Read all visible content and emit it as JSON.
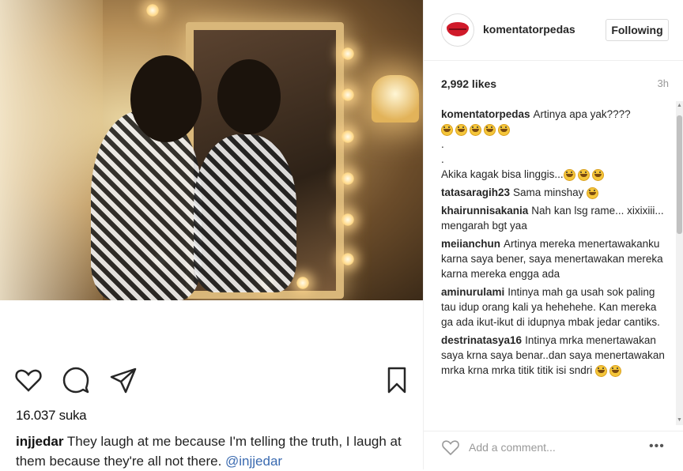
{
  "post": {
    "likes_count": "16.037 suka",
    "caption_user": "injjedar",
    "caption_text": " They laugh at me because I'm telling the truth, I laugh at them because they're all not there. ",
    "caption_mention": "@injjedar"
  },
  "header": {
    "username": "komentatorpedas",
    "follow_label": "Following"
  },
  "stats": {
    "likes": "2,992 likes",
    "time": "3h"
  },
  "comments": [
    {
      "user": "komentatorpedas",
      "text": "Artinya apa yak????"
    },
    {
      "user": "",
      "text": "."
    },
    {
      "user": "",
      "text": "."
    },
    {
      "user": "",
      "text": "Akika kagak bisa linggis..."
    },
    {
      "user": "tatasaragih23",
      "text": "Sama minshay"
    },
    {
      "user": "khairunnisakania",
      "text": "Nah kan lsg rame... xixixiii... mengarah bgt yaa"
    },
    {
      "user": "meiianchun",
      "text": "Artinya mereka menertawakanku karna saya bener, saya menertawakan mereka karna mereka engga ada"
    },
    {
      "user": "aminurulami",
      "text": "Intinya mah ga usah sok paling tau idup orang kali ya hehehehe. Kan mereka ga ada ikut-ikut di idupnya mbak jedar cantiks."
    },
    {
      "user": "destrinatasya16",
      "text": "Intinya mrka menertawakan saya krna saya benar..dan saya menertawakan mrka krna mrka titik titik isi sndri"
    }
  ],
  "add_comment": {
    "placeholder": "Add a comment..."
  },
  "colors": {
    "accent_link": "#3a6ab0",
    "brand_red": "#d01a2a"
  }
}
